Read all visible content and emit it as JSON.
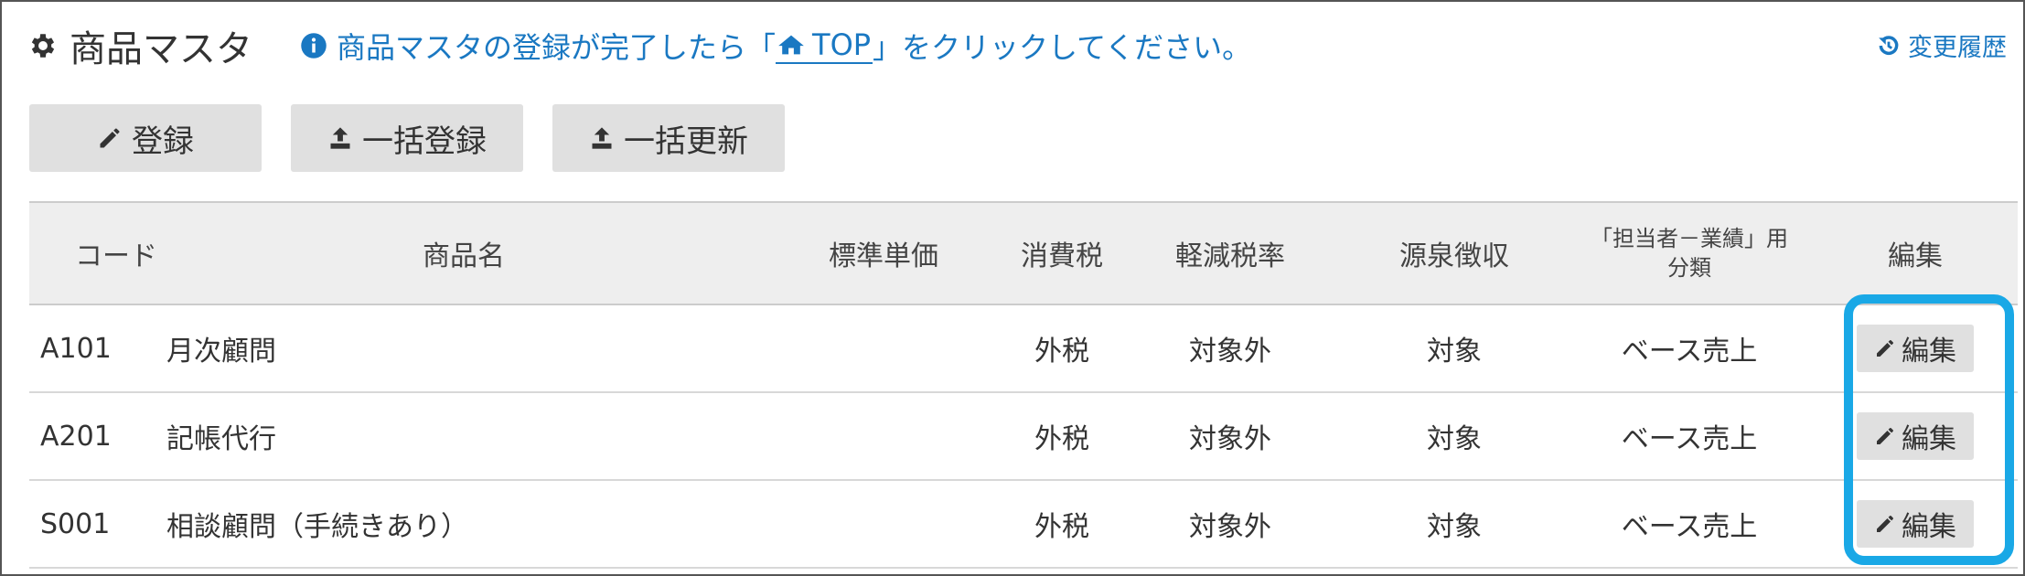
{
  "header": {
    "title": "商品マスタ",
    "title_icon": "gear-icon",
    "info_icon": "info-circle-icon",
    "info_prefix": "商品マスタの登録が完了したら「",
    "top_link_label": "TOP",
    "top_link_icon": "home-icon",
    "info_suffix": "」をクリックしてください。",
    "history_label": "変更履歴",
    "history_icon": "history-icon"
  },
  "toolbar": {
    "register_label": "登録",
    "register_icon": "pencil-icon",
    "bulk_register_label": "一括登録",
    "bulk_register_icon": "upload-icon",
    "bulk_update_label": "一括更新",
    "bulk_update_icon": "upload-icon"
  },
  "table": {
    "headers": {
      "code": "コード",
      "name": "商品名",
      "price": "標準単価",
      "tax": "消費税",
      "reduced": "軽減税率",
      "source": "源泉徴収",
      "classification_line1": "「担当者－業績」用",
      "classification_line2": "分類",
      "edit": "編集"
    },
    "rows": [
      {
        "code": "A101",
        "name": "月次顧問",
        "price": "",
        "tax": "外税",
        "reduced": "対象外",
        "source": "対象",
        "classification": "ベース売上",
        "edit_label": "編集"
      },
      {
        "code": "A201",
        "name": "記帳代行",
        "price": "",
        "tax": "外税",
        "reduced": "対象外",
        "source": "対象",
        "classification": "ベース売上",
        "edit_label": "編集"
      },
      {
        "code": "S001",
        "name": "相談顧問（手続きあり）",
        "price": "",
        "tax": "外税",
        "reduced": "対象外",
        "source": "対象",
        "classification": "ベース売上",
        "edit_label": "編集"
      }
    ]
  },
  "colors": {
    "accent": "#1a78c2",
    "highlight": "#19a8e6",
    "button_bg": "#e0e0e0",
    "header_bg": "#eeeeee"
  }
}
